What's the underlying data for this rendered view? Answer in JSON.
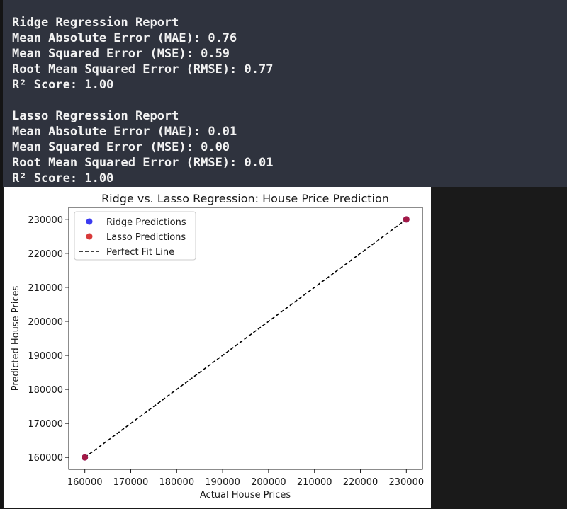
{
  "report": {
    "ridge": {
      "heading": "Ridge Regression Report",
      "mae": "Mean Absolute Error (MAE): 0.76",
      "mse": "Mean Squared Error (MSE): 0.59",
      "rmse": "Root Mean Squared Error (RMSE): 0.77",
      "r2": "R² Score: 1.00"
    },
    "lasso": {
      "heading": "Lasso Regression Report",
      "mae": "Mean Absolute Error (MAE): 0.01",
      "mse": "Mean Squared Error (MSE): 0.00",
      "rmse": "Root Mean Squared Error (RMSE): 0.01",
      "r2": "R² Score: 1.00"
    }
  },
  "colors": {
    "ridge": "#3b3bf0",
    "lasso": "#d83a3a",
    "overlap": "#a8163c",
    "fit_line": "#000000"
  },
  "chart_data": {
    "type": "scatter",
    "title": "Ridge vs. Lasso Regression: House Price Prediction",
    "xlabel": "Actual House Prices",
    "ylabel": "Predicted House Prices",
    "xlim": [
      156500,
      233500
    ],
    "ylim": [
      156500,
      233500
    ],
    "x_ticks": [
      160000,
      170000,
      180000,
      190000,
      200000,
      210000,
      220000,
      230000
    ],
    "y_ticks": [
      160000,
      170000,
      180000,
      190000,
      200000,
      210000,
      220000,
      230000
    ],
    "legend_position": "top-left",
    "grid": false,
    "series": [
      {
        "name": "Ridge Predictions",
        "kind": "scatter",
        "x": [
          160000,
          230000
        ],
        "y": [
          160000,
          230000
        ]
      },
      {
        "name": "Lasso Predictions",
        "kind": "scatter",
        "x": [
          160000,
          230000
        ],
        "y": [
          160000,
          230000
        ]
      },
      {
        "name": "Perfect Fit Line",
        "kind": "line",
        "style": "dashed",
        "x": [
          160000,
          230000
        ],
        "y": [
          160000,
          230000
        ]
      }
    ]
  }
}
